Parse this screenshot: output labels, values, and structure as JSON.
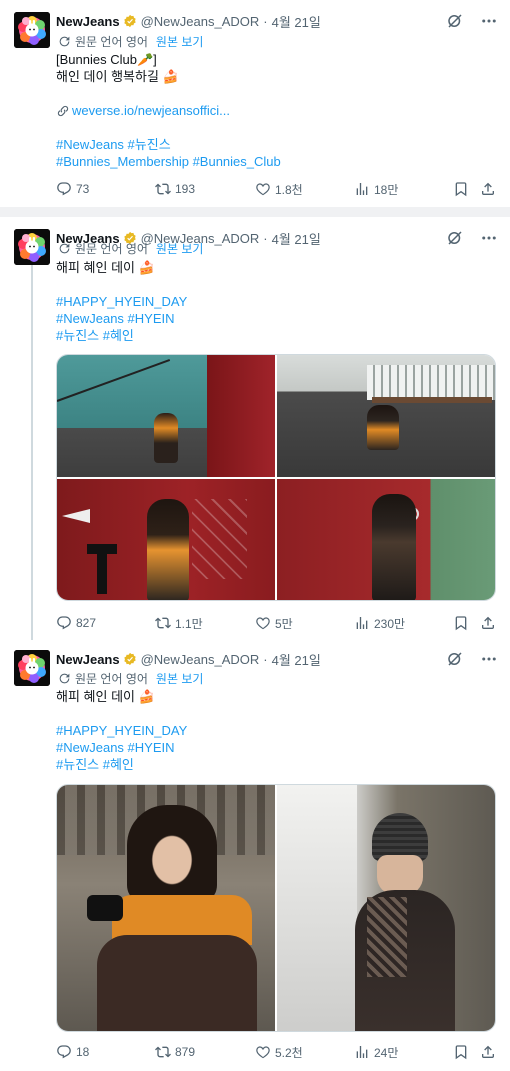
{
  "colors": {
    "link": "#1d9bf0",
    "text": "#0f1419",
    "muted": "#536471",
    "divider": "#f0f1f3",
    "verified": "#e8b923"
  },
  "tweets": [
    {
      "name": "NewJeans",
      "handle": "@NewJeans_ADOR",
      "dot": "·",
      "date": "4월 21일",
      "translate_label": "원문 언어 영어",
      "translate_link": "원본 보기",
      "lines": [
        "[Bunnies Club🥕]",
        "해인 데이 행복하길 🍰",
        "",
        "weverse.io/newjeansoffici...",
        "",
        "#NewJeans #뉴진스",
        "#Bunnies_Membership #Bunnies_Club"
      ],
      "stats": {
        "replies": "73",
        "reposts": "193",
        "likes": "1.8천",
        "views": "18만"
      }
    },
    {
      "name": "NewJeans",
      "handle": "@NewJeans_ADOR",
      "dot": "·",
      "date": "4월 21일",
      "translate_label": "원문 언어 영어",
      "translate_link": "원본 보기",
      "lines": [
        "해피 혜인 데이 🍰",
        "",
        "#HAPPY_HYEIN_DAY",
        "#NewJeans #HYEIN",
        "#뉴진스 #혜인"
      ],
      "stats": {
        "replies": "827",
        "reposts": "1.1만",
        "likes": "5만",
        "views": "230만"
      }
    },
    {
      "name": "NewJeans",
      "handle": "@NewJeans_ADOR",
      "dot": "·",
      "date": "4월 21일",
      "translate_label": "원문 언어 영어",
      "translate_link": "원본 보기",
      "lines": [
        "해피 혜인 데이 🍰",
        "",
        "#HAPPY_HYEIN_DAY",
        "#NewJeans #HYEIN",
        "#뉴진스 #혜인"
      ],
      "stats": {
        "replies": "18",
        "reposts": "879",
        "likes": "5.2천",
        "views": "24만"
      }
    }
  ]
}
